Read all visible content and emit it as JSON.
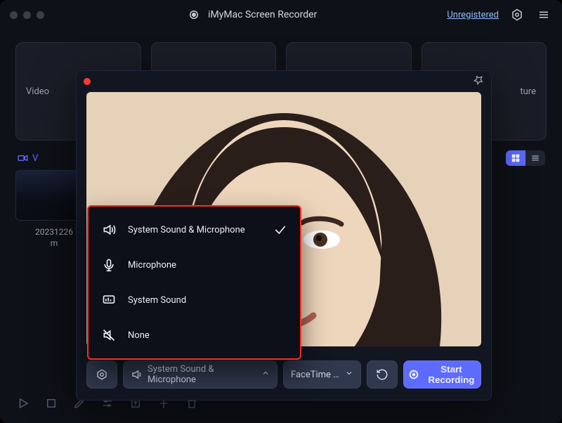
{
  "titlebar": {
    "app_name": "iMyMac Screen Recorder",
    "unregistered_label": "Unregistered"
  },
  "modes": {
    "card0": "Video",
    "card3_suffix": "ture"
  },
  "files": {
    "tab_label": "V",
    "item0_name": "20231226\nm"
  },
  "overlay": {
    "settings_label": "",
    "audio_selected": "System Sound & Microphone",
    "camera_selected": "FaceTime …",
    "start_label": "Start Recording"
  },
  "audio_menu": {
    "options": {
      "opt0": "System Sound & Microphone",
      "opt1": "Microphone",
      "opt2": "System Sound",
      "opt3": "None"
    },
    "selected_index": 0
  }
}
